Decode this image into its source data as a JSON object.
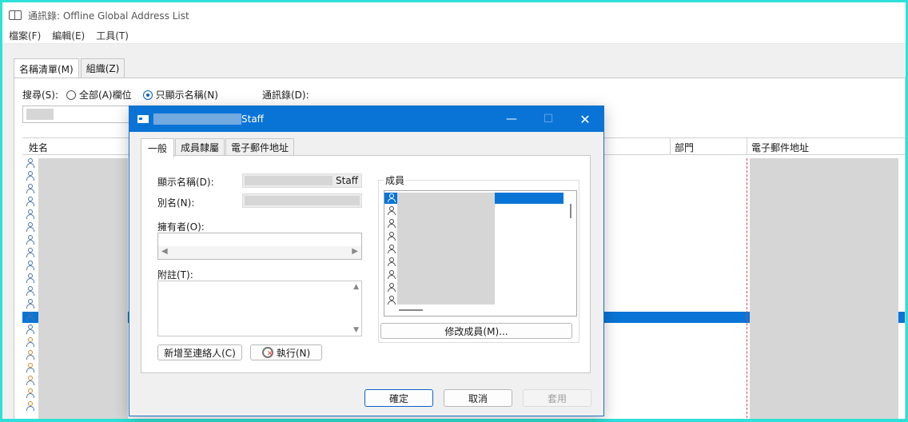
{
  "window": {
    "title": "通訊錄: Offline Global Address List"
  },
  "menu": [
    "檔案(F)",
    "編輯(E)",
    "工具(T)"
  ],
  "main_tabs": [
    "名稱清單(M)",
    "組織(Z)"
  ],
  "search": {
    "label": "搜尋(S):",
    "option_all": "全部(A)欄位",
    "option_name": "只顯示名稱(N)",
    "address_book_label": "通訊錄(D):"
  },
  "columns": {
    "name": "姓名",
    "department": "部門",
    "email": "電子郵件地址"
  },
  "dialog": {
    "title_suffix": "Staff",
    "minimize": "—",
    "maximize": "☐",
    "close": "✕",
    "tabs": [
      "一般",
      "成員隸屬",
      "電子郵件地址"
    ],
    "display_name_label": "顯示名稱(D):",
    "display_name_suffix": "Staff",
    "alias_label": "別名(N):",
    "owner_label": "擁有者(O):",
    "notes_label": "附註(T):",
    "members_label": "成員",
    "modify_members": "修改成員(M)...",
    "add_contact": "新增至連絡人(C)",
    "execute": "執行(N)",
    "ok": "確定",
    "cancel": "取消",
    "apply": "套用"
  },
  "colors": {
    "accent": "#0a74d6",
    "title_bar": "#0a74d6",
    "redaction": "#d6d6d6"
  }
}
